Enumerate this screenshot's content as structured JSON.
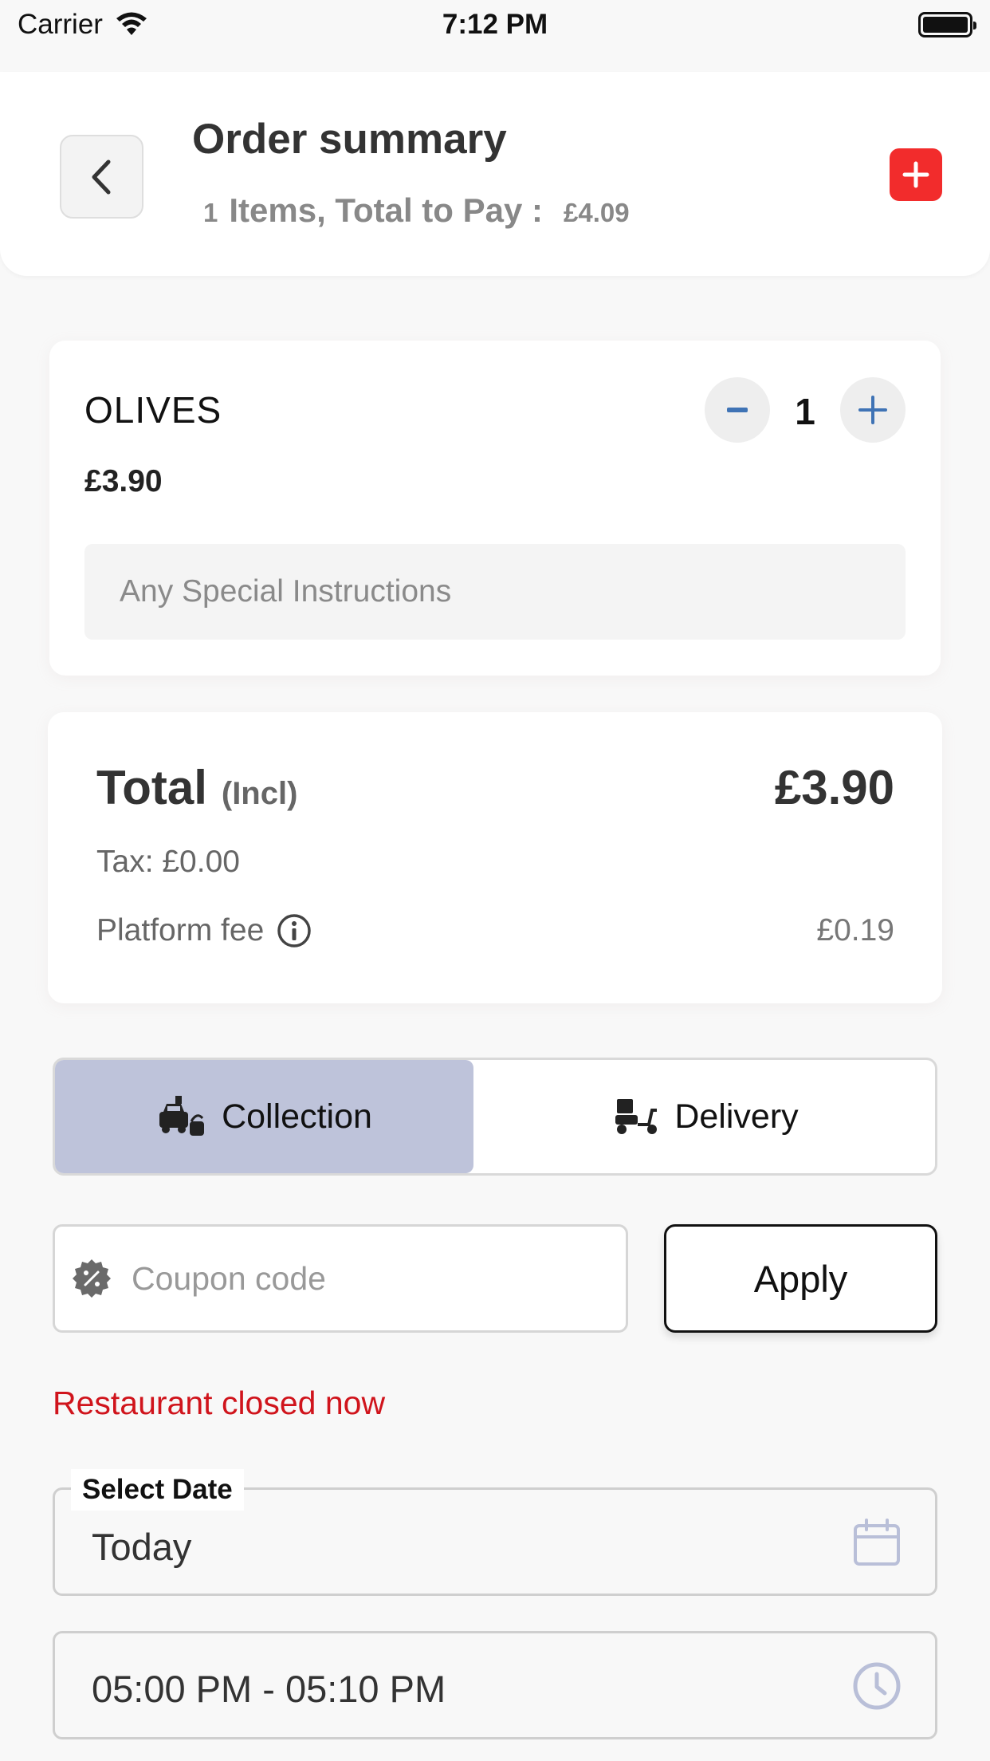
{
  "status_bar": {
    "carrier": "Carrier",
    "time": "7:12 PM"
  },
  "header": {
    "title": "Order summary",
    "item_count": "1",
    "summary_text": "Items, Total to Pay :",
    "total_to_pay": "£4.09",
    "accent_color": "#f22c2c"
  },
  "item": {
    "name": "OLIVES",
    "price": "£3.90",
    "quantity": "1",
    "instructions_placeholder": "Any Special Instructions"
  },
  "totals": {
    "label": "Total",
    "incl": "(Incl)",
    "amount": "£3.90",
    "tax": "Tax: £0.00",
    "platform_fee_label": "Platform fee",
    "platform_fee_amount": "£0.19"
  },
  "order_mode": {
    "collection_label": "Collection",
    "delivery_label": "Delivery",
    "selected": "collection",
    "selected_color": "#bec3da"
  },
  "coupon": {
    "placeholder": "Coupon code",
    "apply_label": "Apply"
  },
  "status_message": {
    "text": "Restaurant closed now",
    "color": "#d0141c"
  },
  "schedule": {
    "date_label": "Select Date",
    "date_value": "Today",
    "time_value": "05:00 PM - 05:10 PM"
  }
}
